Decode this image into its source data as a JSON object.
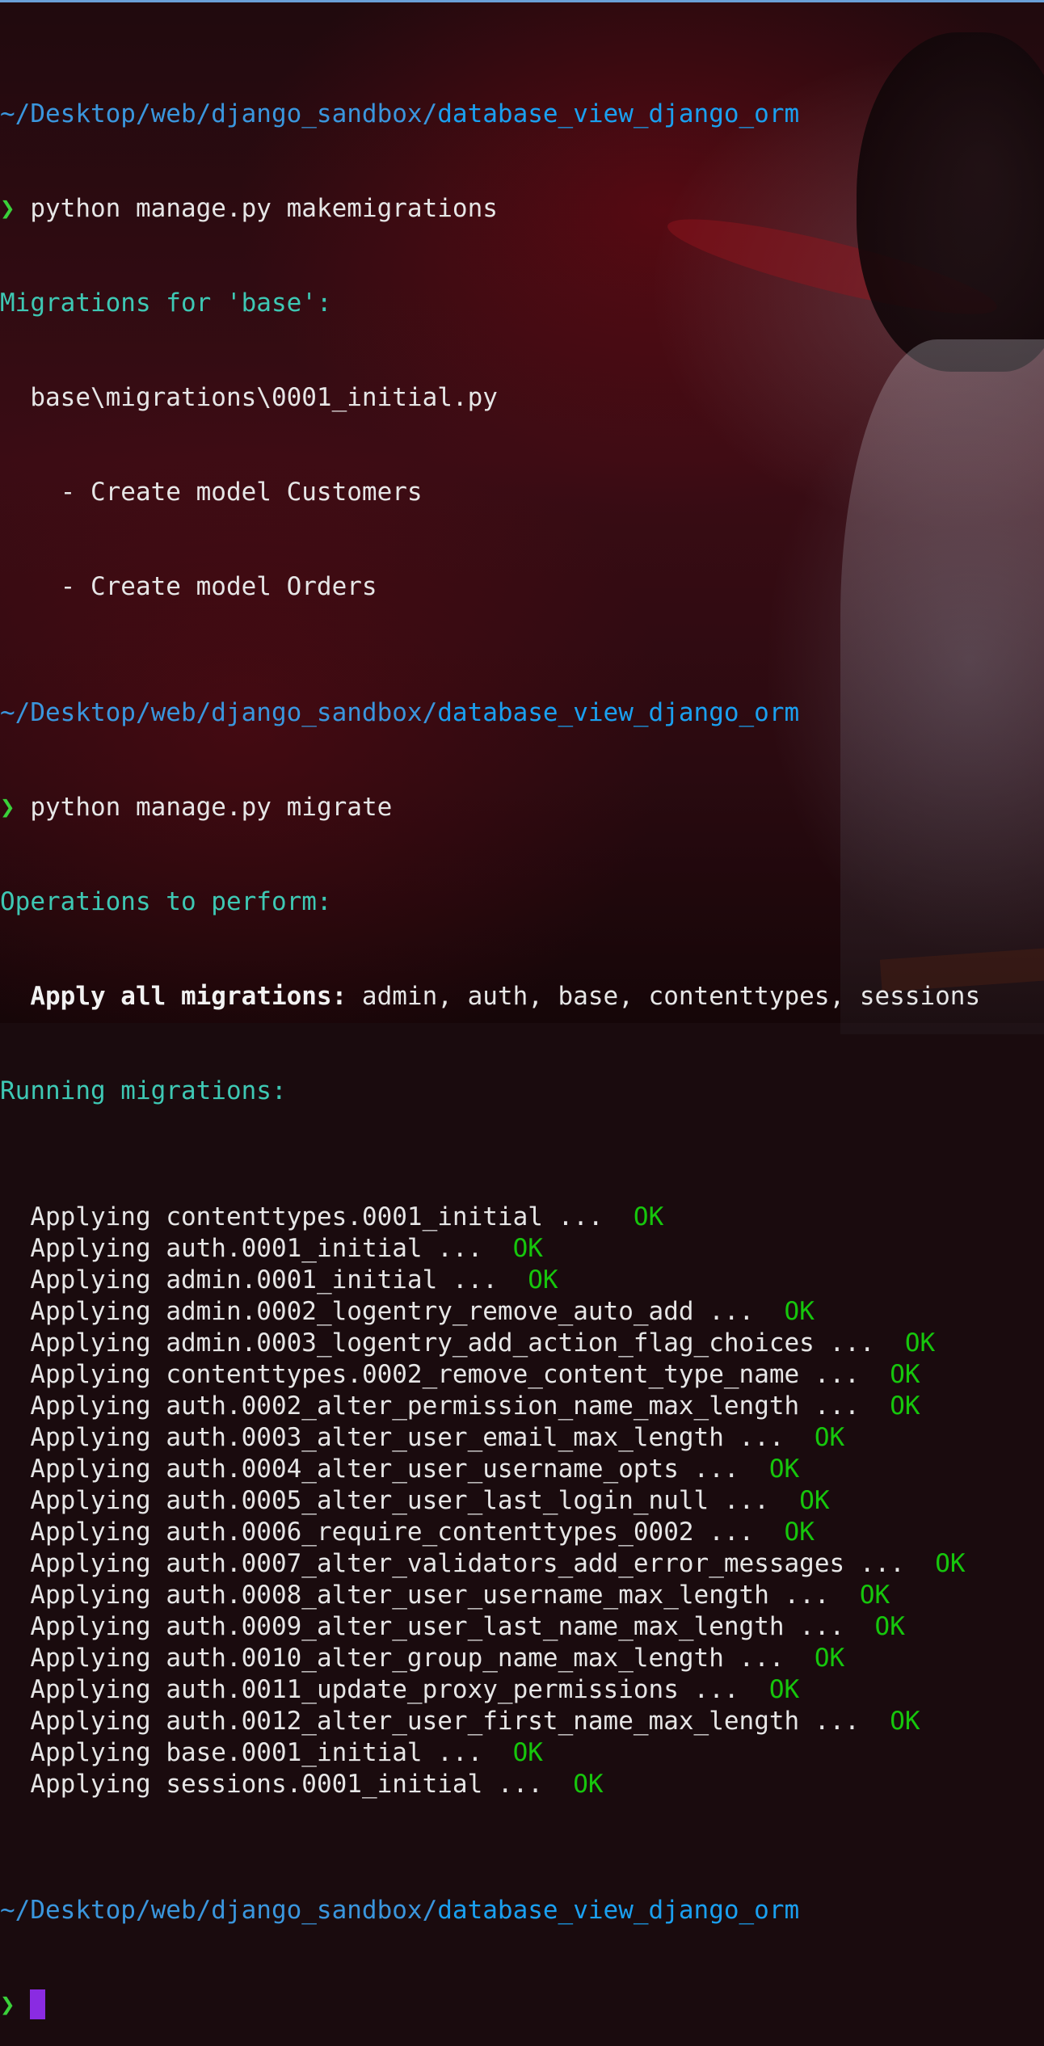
{
  "colors": {
    "path_base": "#3a96dd",
    "path_last": "#1aa0f0",
    "prompt_arrow": "#3ad13a",
    "section_header": "#3ec8b4",
    "ok": "#16c60c",
    "cursor": "#8a2be2"
  },
  "prompt": {
    "path_prefix": "~/Desktop/web/django_sandbox/",
    "path_dir": "database_view_django_orm",
    "arrow": "❯"
  },
  "commands": {
    "makemigrations": "python manage.py makemigrations",
    "migrate": "python manage.py migrate"
  },
  "makemigrations_output": {
    "header": "Migrations for 'base':",
    "file": "  base\\migrations\\0001_initial.py",
    "models": [
      "    - Create model Customers",
      "    - Create model Orders"
    ]
  },
  "migrate_output": {
    "operations_header": "Operations to perform:",
    "apply_label": "  Apply all migrations:",
    "apply_apps": " admin, auth, base, contenttypes, sessions",
    "running_header": "Running migrations:",
    "applying_prefix": "  Applying ",
    "dots": "... ",
    "ok_label": "OK",
    "migrations": [
      "contenttypes.0001_initial",
      "auth.0001_initial",
      "admin.0001_initial",
      "admin.0002_logentry_remove_auto_add",
      "admin.0003_logentry_add_action_flag_choices",
      "contenttypes.0002_remove_content_type_name",
      "auth.0002_alter_permission_name_max_length",
      "auth.0003_alter_user_email_max_length",
      "auth.0004_alter_user_username_opts",
      "auth.0005_alter_user_last_login_null",
      "auth.0006_require_contenttypes_0002",
      "auth.0007_alter_validators_add_error_messages",
      "auth.0008_alter_user_username_max_length",
      "auth.0009_alter_user_last_name_max_length",
      "auth.0010_alter_group_name_max_length",
      "auth.0011_update_proxy_permissions",
      "auth.0012_alter_user_first_name_max_length",
      "base.0001_initial",
      "sessions.0001_initial"
    ]
  }
}
